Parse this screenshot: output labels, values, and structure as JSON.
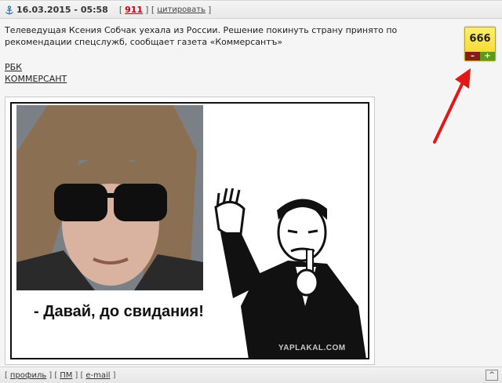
{
  "post": {
    "date": "16.03.2015 - 05:58",
    "number": "911",
    "quote_label": "цитировать",
    "text": "Телеведущая Ксения Собчак уехала из России. Решение покинуть страну принято по рекомендации спецслужб, сообщает газета «Коммерсантъ»",
    "links": [
      "РБК",
      "КОММЕРСАНТ"
    ]
  },
  "rating": {
    "value": "666",
    "minus": "–",
    "plus": "+"
  },
  "meme": {
    "caption": "- Давай, до свидания!",
    "watermark": "YAPLAKAL.COM"
  },
  "footer": {
    "profile": "профиль",
    "pm": "ПМ",
    "email": "e-mail",
    "top": "^"
  },
  "colors": {
    "rating_bg": "#f2d52a",
    "minus": "#8b1a1a",
    "plus": "#5d9a1a",
    "arrow": "#e01818",
    "number": "#cc0000"
  }
}
